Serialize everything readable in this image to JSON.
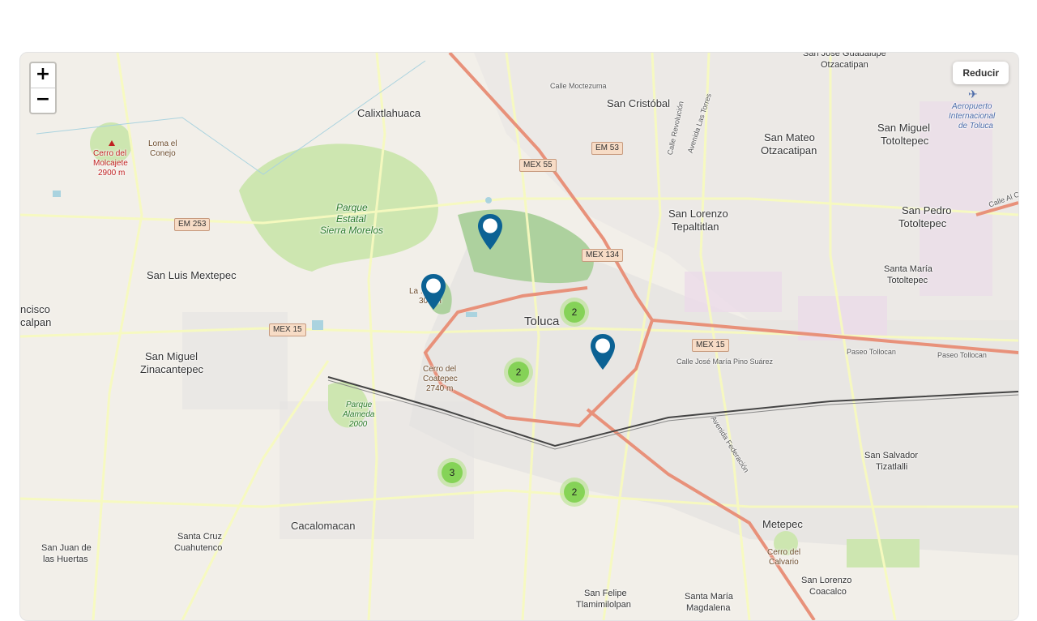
{
  "map": {
    "zoom_in_label": "+",
    "zoom_out_label": "−",
    "reduce_button_label": "Reducir",
    "colors": {
      "land": "#f2efe9",
      "park": "#cde6b0",
      "forest": "#add19e",
      "residential": "#e0dfdf",
      "industrial": "#ebdbe8",
      "major_road": "#e8917a",
      "secondary_road": "#f7fabf",
      "marker": "#0c6294",
      "cluster_inner": "#6ecc39",
      "cluster_outer": "#b5e28c"
    },
    "places": [
      "Calixtlahuaca",
      "San Cristóbal",
      "San Mateo",
      "Otzacatipan",
      "San Miguel",
      "Totoltepec",
      "San José Guadalupe",
      "Otzacatipan",
      "San Lorenzo",
      "Tepaltitlan",
      "San Pedro",
      "Totoltepec",
      "Santa María",
      "Totoltepec",
      "San Luis Mextepec",
      "Toluca",
      "San Miguel",
      "Zinacantepec",
      "Cacalomacan",
      "San Juan de",
      "las Huertas",
      "Santa Cruz",
      "Cuahutenco",
      "Metepec",
      "San Salvador",
      "Tizatlalli",
      "San Felipe",
      "Tlamimilolpan",
      "Santa María",
      "Magdalena",
      "San Lorenzo",
      "Coacalco",
      "ncisco",
      "calpan"
    ],
    "parks": [
      "Parque",
      "Estatal",
      "Sierra Morelos",
      "Parque",
      "Alameda",
      "2000"
    ],
    "peaks": [
      "Cerro del",
      "Molcajete",
      "2900 m",
      "Loma el",
      "Conejo",
      "La ...ina",
      "30.. m",
      "Cerro del",
      "Coatepec",
      "2740 m",
      "Cerro del",
      "Calvario"
    ],
    "airport": [
      "Aeropuerto",
      "Internacional",
      "de Toluca"
    ],
    "shields": [
      "MEX 55",
      "EM 53",
      "EM 253",
      "MEX 134",
      "MEX 15",
      "MEX 15"
    ],
    "streets": [
      "Calle Moctezuma",
      "Calle José María Pino Suárez",
      "Paseo Tollocan",
      "Paseo Tollocan",
      "Avenida Federación",
      "Calle Al Ce...",
      "Avenida Las Torres",
      "Calle Revolución"
    ],
    "clusters": [
      {
        "count": "2"
      },
      {
        "count": "2"
      },
      {
        "count": "3"
      },
      {
        "count": "2"
      }
    ],
    "markers": 3
  }
}
